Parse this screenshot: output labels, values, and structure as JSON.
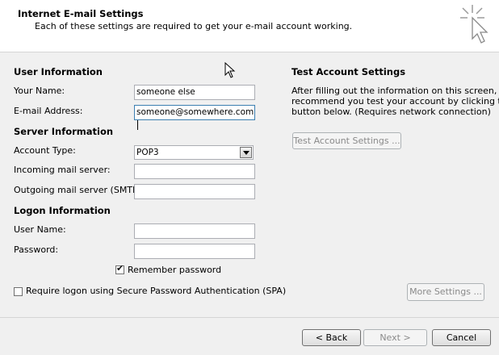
{
  "header": {
    "title": "Internet E-mail Settings",
    "subtitle": "Each of these settings are required to get your e-mail account working."
  },
  "user_info": {
    "heading": "User Information",
    "name_label": "Your Name:",
    "name_value": "someone else",
    "email_label": "E-mail Address:",
    "email_value": "someone@somewhere.com"
  },
  "server_info": {
    "heading": "Server Information",
    "account_type_label": "Account Type:",
    "account_type_value": "POP3",
    "incoming_label": "Incoming mail server:",
    "incoming_value": "",
    "outgoing_label": "Outgoing mail server (SMTP):",
    "outgoing_value": ""
  },
  "logon_info": {
    "heading": "Logon Information",
    "username_label": "User Name:",
    "username_value": "",
    "password_label": "Password:",
    "password_value": "",
    "remember_label": "Remember password",
    "remember_checked": true,
    "spa_label": "Require logon using Secure Password Authentication (SPA)",
    "spa_checked": false
  },
  "test": {
    "heading": "Test Account Settings",
    "description_lines": [
      "After filling out the information on this screen, we",
      "recommend you test your account by clicking the",
      "button below. (Requires network connection)"
    ],
    "button_label": "Test Account Settings ..."
  },
  "buttons": {
    "more_settings": "More Settings ...",
    "back": "< Back",
    "next": "Next >",
    "cancel": "Cancel"
  },
  "icons": {
    "header_icon": "wizard-cursor-icon",
    "mouse_pointer": "mouse-pointer-icon"
  }
}
